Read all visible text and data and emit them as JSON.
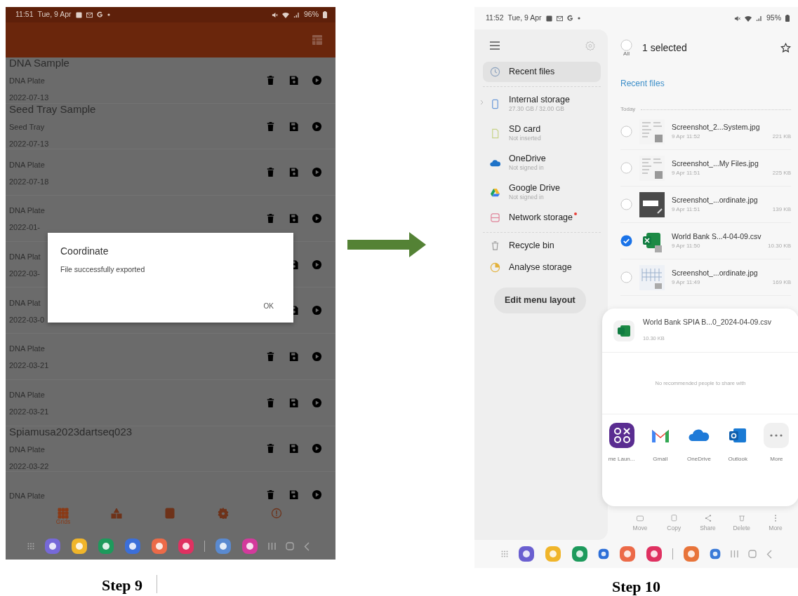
{
  "step9": {
    "status_bar": {
      "time": "11:51",
      "date": "Tue, 9 Apr",
      "battery": "96%"
    },
    "records": [
      {
        "title": "DNA Sample",
        "type": "DNA Plate",
        "date": "2022-07-13",
        "actions": [
          {
            "kind": "delete"
          },
          {
            "kind": "save"
          },
          {
            "kind": "open"
          }
        ]
      },
      {
        "title": "Seed Tray Sample",
        "type": "Seed Tray",
        "date": "2022-07-13",
        "actions": [
          {
            "kind": "delete"
          },
          {
            "kind": "save"
          },
          {
            "kind": "open"
          }
        ]
      },
      {
        "type": "DNA Plate",
        "date": "2022-07-18",
        "actions": [
          {
            "kind": "delete"
          },
          {
            "kind": "save"
          },
          {
            "kind": "open"
          }
        ]
      },
      {
        "type": "DNA Plate",
        "date": "2022-01-",
        "actions": [
          {
            "kind": "delete"
          },
          {
            "kind": "save"
          },
          {
            "kind": "open"
          }
        ]
      },
      {
        "type": "DNA Plat",
        "date": "2022-03-",
        "actions": [
          {
            "kind": "save"
          },
          {
            "kind": "open"
          }
        ]
      },
      {
        "type": "DNA Plat",
        "date": "2022-03-0",
        "actions": [
          {
            "kind": "save"
          },
          {
            "kind": "open"
          }
        ]
      },
      {
        "type": "DNA Plate",
        "date": "2022-03-21",
        "actions": [
          {
            "kind": "delete"
          },
          {
            "kind": "save"
          },
          {
            "kind": "open"
          }
        ]
      },
      {
        "type": "DNA Plate",
        "date": "2022-03-21",
        "actions": [
          {
            "kind": "delete"
          },
          {
            "kind": "save"
          },
          {
            "kind": "open"
          }
        ]
      },
      {
        "title": "Spiamusa2023dartseq023",
        "type": "DNA Plate",
        "date": "2022-03-22",
        "actions": [
          {
            "kind": "delete"
          },
          {
            "kind": "save"
          },
          {
            "kind": "open"
          }
        ]
      },
      {
        "type": "DNA Plate",
        "actions": [
          {
            "kind": "delete"
          },
          {
            "kind": "save"
          },
          {
            "kind": "open"
          }
        ]
      }
    ],
    "dialog": {
      "title": "Coordinate",
      "message": "File successfully exported",
      "button": "OK"
    },
    "bottom_nav": [
      {
        "kind": "grid",
        "label": "Grids",
        "selected": true
      },
      {
        "kind": "shapes",
        "selected": false
      },
      {
        "kind": "book",
        "selected": false
      },
      {
        "kind": "settings",
        "selected": false
      },
      {
        "kind": "info",
        "selected": false
      }
    ],
    "caption": "Step 9"
  },
  "step10": {
    "status_bar": {
      "time": "11:52",
      "date": "Tue, 9 Apr",
      "battery": "95%"
    },
    "drawer": {
      "groups": [
        {
          "items": [
            {
              "kind": "recent",
              "label": "Recent files",
              "selected": true
            }
          ]
        },
        {
          "items": [
            {
              "kind": "internal",
              "label": "Internal storage",
              "detail": "27.30 GB / 32.00 GB",
              "selected": false
            },
            {
              "kind": "sd",
              "label": "SD card",
              "detail": "Not inserted",
              "selected": false
            },
            {
              "kind": "onedrive",
              "label": "OneDrive",
              "detail": "Not signed in",
              "selected": false
            },
            {
              "kind": "gdrive",
              "label": "Google Drive",
              "detail": "Not signed in",
              "selected": false
            },
            {
              "kind": "network",
              "label": "Network storage",
              "badge": true,
              "selected": false
            }
          ]
        },
        {
          "items": [
            {
              "kind": "recycle",
              "label": "Recycle bin",
              "selected": false
            },
            {
              "kind": "analyse",
              "label": "Analyse storage",
              "selected": false
            }
          ]
        }
      ],
      "button": "Edit menu layout"
    },
    "selection": {
      "all_label": "All",
      "all_checked": false,
      "count_label": "1 selected"
    },
    "section_title": "Recent files",
    "group_label": "Today",
    "files": [
      {
        "name": "Screenshot_2...System.jpg",
        "time": "9 Apr 11:52",
        "size": "221 KB",
        "kind": "light",
        "selected": false
      },
      {
        "name": "Screenshot_...My Files.jpg",
        "time": "9 Apr 11:51",
        "size": "225 KB",
        "kind": "light",
        "selected": false
      },
      {
        "name": "Screenshot_...ordinate.jpg",
        "time": "9 Apr 11:51",
        "size": "139 KB",
        "kind": "dark",
        "selected": false
      },
      {
        "name": "World Bank S...4-04-09.csv",
        "time": "9 Apr 11:50",
        "size": "10.30 KB",
        "kind": "csv",
        "selected": true
      },
      {
        "name": "Screenshot_...ordinate.jpg",
        "time": "9 Apr 11:49",
        "size": "169 KB",
        "kind": "table",
        "selected": false
      }
    ],
    "share_sheet": {
      "file_name": "World Bank SPIA B...0_2024-04-09.csv",
      "file_size": "10.30 KB",
      "message": "No recommended people to share with",
      "apps": [
        {
          "kind": "launcher",
          "label": "me Laun..."
        },
        {
          "kind": "gmail",
          "label": "Gmail"
        },
        {
          "kind": "onedrive",
          "label": "OneDrive"
        },
        {
          "kind": "outlook",
          "label": "Outlook"
        },
        {
          "kind": "more",
          "label": "More"
        }
      ]
    },
    "toolbar": [
      {
        "kind": "move",
        "label": "Move"
      },
      {
        "kind": "copy",
        "label": "Copy"
      },
      {
        "kind": "share",
        "label": "Share"
      },
      {
        "kind": "delete",
        "label": "Delete"
      },
      {
        "kind": "more",
        "label": "More"
      }
    ],
    "caption": "Step 10"
  }
}
